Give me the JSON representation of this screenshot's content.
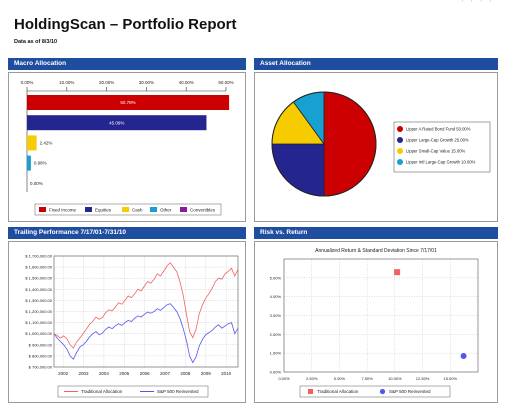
{
  "header": {
    "corner_marks": "' ' ' '",
    "title": "HoldingScan – Portfolio Report",
    "date": "Data as of 8/3/10"
  },
  "panels": {
    "macro": "Macro Allocation",
    "asset": "Asset Allocation",
    "trailing": "Trailing Performance 7/17/01-7/31/10",
    "risk": "Risk vs. Return"
  },
  "colors": {
    "panel_header": "#1f4ea1",
    "red": "#cc0000",
    "navy": "#24258f",
    "yellow": "#f6cc00",
    "cyan": "#18a0d0",
    "purple": "#8a1a99",
    "blue": "#2a2ae0",
    "salmon": "#f06262",
    "violet": "#5555ee"
  },
  "chart_data": [
    {
      "id": "macro",
      "type": "bar",
      "orientation": "horizontal",
      "categories": [
        "Fixed Income",
        "Equities",
        "Cash",
        "Other",
        "Convertibles"
      ],
      "values": [
        50.78,
        45.09,
        2.42,
        0.98,
        0.0
      ],
      "value_labels": [
        "50.78%",
        "45.09%",
        "2.42%",
        "0.98%",
        "0.00%"
      ],
      "colors": [
        "#cc0000",
        "#24258f",
        "#f6cc00",
        "#18a0d0",
        "#8a1a99"
      ],
      "xlim": [
        0,
        50
      ],
      "xticks": [
        "0.00%",
        "10.00%",
        "20.00%",
        "30.00%",
        "40.00%",
        "50.00%"
      ],
      "legend": [
        "Fixed Income",
        "Equities",
        "Cash",
        "Other",
        "Convertibles"
      ],
      "legend_position": "bottom"
    },
    {
      "id": "asset",
      "type": "pie",
      "labels": [
        "Lipper A Rated Bond Fund 50.00%",
        "Lipper Large-Cap Growth 25.00%",
        "Lipper Small-Cap Value 15.00%",
        "Lipper Intl Large-Cap Growth 10.00%"
      ],
      "values": [
        50,
        25,
        15,
        10
      ],
      "colors": [
        "#cc0000",
        "#24258f",
        "#f6cc00",
        "#18a0d0"
      ],
      "legend_position": "right"
    },
    {
      "id": "trailing",
      "type": "line",
      "x_start": 2001.55,
      "x_end": 2010.58,
      "xticks": [
        "2002",
        "2003",
        "2004",
        "2005",
        "2006",
        "2007",
        "2008",
        "2009",
        "2010"
      ],
      "ylim": [
        700000,
        1700000
      ],
      "yticks": [
        "$ 1,700,000.00",
        "$ 1,600,000.00",
        "$ 1,500,000.00",
        "$ 1,400,000.00",
        "$ 1,300,000.00",
        "$ 1,200,000.00",
        "$ 1,100,000.00",
        "$ 1,000,000.00",
        "$ 900,000.00",
        "$ 800,000.00",
        "$ 700,000.00"
      ],
      "grid": true,
      "legend_position": "bottom",
      "series": [
        {
          "name": "Traditional Allocation",
          "color": "#f06262",
          "values": [
            1000000,
            985000,
            960000,
            980000,
            955000,
            900000,
            870000,
            925000,
            960000,
            1000000,
            1040000,
            1085000,
            1110000,
            1150000,
            1130000,
            1145000,
            1190000,
            1215000,
            1205000,
            1240000,
            1280000,
            1265000,
            1300000,
            1340000,
            1325000,
            1360000,
            1400000,
            1385000,
            1430000,
            1470000,
            1455000,
            1490000,
            1540000,
            1520000,
            1565000,
            1610000,
            1640000,
            1600000,
            1560000,
            1470000,
            1350000,
            1180000,
            1020000,
            965000,
            1040000,
            1180000,
            1260000,
            1320000,
            1360000,
            1410000,
            1470000,
            1500000,
            1490000,
            1540000,
            1560000,
            1590000,
            1520000,
            1580000
          ]
        },
        {
          "name": "S&P 500 Reinvested",
          "color": "#5555ee",
          "values": [
            1000000,
            960000,
            930000,
            900000,
            860000,
            800000,
            770000,
            830000,
            880000,
            900000,
            930000,
            970000,
            1000000,
            1020000,
            990000,
            1005000,
            1040000,
            1060000,
            1045000,
            1070000,
            1090000,
            1075000,
            1100000,
            1120000,
            1110000,
            1140000,
            1160000,
            1150000,
            1175000,
            1195000,
            1185000,
            1200000,
            1225000,
            1210000,
            1235000,
            1260000,
            1270000,
            1240000,
            1200000,
            1140000,
            1050000,
            940000,
            800000,
            740000,
            790000,
            890000,
            950000,
            990000,
            1010000,
            1030000,
            1060000,
            1080000,
            1050000,
            1070000,
            1090000,
            1100000,
            1000000,
            1050000
          ]
        }
      ]
    },
    {
      "id": "risk",
      "type": "scatter",
      "title": "Annualized Return & Standard Deviation Since 7/17/01",
      "xlim": [
        0,
        17.5
      ],
      "ylim": [
        0,
        6
      ],
      "xticks": [
        "0.00%",
        "2.50%",
        "5.00%",
        "7.50%",
        "10.00%",
        "12.50%",
        "15.00%"
      ],
      "yticks": [
        "0.00%",
        "1.00%",
        "2.00%",
        "3.00%",
        "4.00%",
        "5.00%"
      ],
      "grid": true,
      "legend_position": "bottom",
      "series": [
        {
          "name": "Traditional Allocation",
          "color": "#f06262",
          "marker": "square",
          "x": [
            10.2
          ],
          "y": [
            5.3
          ]
        },
        {
          "name": "S&P 500 Reinvested",
          "color": "#5555ee",
          "marker": "circle",
          "x": [
            16.2
          ],
          "y": [
            0.85
          ]
        }
      ]
    }
  ]
}
